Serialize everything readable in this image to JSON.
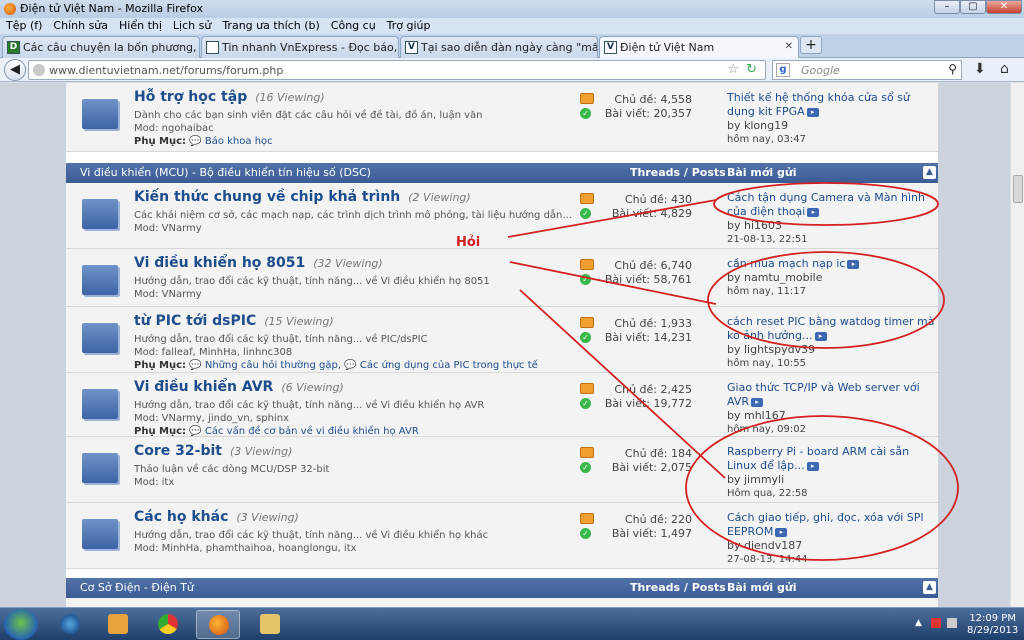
{
  "window": {
    "title": "Điện tử Việt Nam - Mozilla Firefox",
    "controls": [
      "–",
      "▢",
      "✕"
    ]
  },
  "menu": [
    "Tệp (f)",
    "Chỉnh sửa",
    "Hiển thị",
    "Lịch sử",
    "Trang ưa thích (b)",
    "Công cụ",
    "Trợ giúp"
  ],
  "tabs": [
    {
      "label": "Các câu chuyện la bốn phương, chuy...",
      "fav": "D"
    },
    {
      "label": "Tin nhanh VnExpress - Đọc báo, tin tứ...",
      "fav": ""
    },
    {
      "label": "Tại sao diễn đàn ngày càng \"mất lửa\"...",
      "fav": "V"
    },
    {
      "label": "Điện tử Việt Nam",
      "fav": "V"
    }
  ],
  "nav": {
    "url": "www.dientuvietnam.net/forums/forum.php",
    "search_placeholder": "Google",
    "search_engine": "g"
  },
  "forum": {
    "top": {
      "title": "Hỗ trợ học tập",
      "viewing": "(16 Viewing)",
      "desc": "Dành cho các bạn sinh viên đặt các câu hỏi về đề tài, đồ án, luận văn",
      "mod": "Mod: ngohaibac",
      "sub_label": "Phụ Mục:",
      "subs": [
        "Báo khoa học"
      ],
      "topics": "Chủ đề: 4,558",
      "posts": "Bài viết: 20,357",
      "last_title": "Thiết kế hệ thống khóa cửa sổ sử dụng kit FPGA",
      "last_by": "by klong19",
      "last_time": "hôm nay, 03:47"
    },
    "section1": {
      "name": "Vi điều khiển (MCU) - Bộ điều khiển tín hiệu số (DSC)",
      "threads_posts": "Threads / Posts",
      "last_post": "Bài mới gửi"
    },
    "rows": [
      {
        "title": "Kiến thức chung về chip khả trình",
        "viewing": "(2 Viewing)",
        "desc": "Các khái niệm cơ sở, các mạch nạp, các trình dịch trình mô phỏng, tài liệu hướng dẫn...",
        "mod": "Mod: VNarmy",
        "subs": [],
        "topics": "Chủ đề: 430",
        "posts": "Bài viết: 4,829",
        "last_title": "Cách tận dụng Camera và Màn hình của điện thoại",
        "last_by": "by hi1603",
        "last_time": "21-08-13, 22:51"
      },
      {
        "title": "Vi điều khiển họ 8051",
        "viewing": "(32 Viewing)",
        "desc": "Hướng dẫn, trao đổi các kỹ thuật, tính năng... về Vi điều khiển họ 8051",
        "mod": "Mod: VNarmy",
        "subs": [],
        "topics": "Chủ đề: 6,740",
        "posts": "Bài viết: 58,761",
        "last_title": "cần mua mạch nạp ic",
        "last_by": "by namtu_mobile",
        "last_time": "hôm nay, 11:17"
      },
      {
        "title": "từ PIC tới dsPIC",
        "viewing": "(15 Viewing)",
        "desc": "Hướng dẫn, trao đổi các kỹ thuật, tính năng... về PIC/dsPIC",
        "mod": "Mod: falleaf, MinhHa, linhnc308",
        "subs": [
          "Những câu hỏi thường gặp,",
          "Các ứng dụng của PIC trong thực tế"
        ],
        "topics": "Chủ đề: 1,933",
        "posts": "Bài viết: 14,231",
        "last_title": "cách reset PIC bằng watdog timer mà ko ảnh hưởng...",
        "last_by": "by lightspydv39",
        "last_time": "hôm nay, 10:55"
      },
      {
        "title": "Vi điều khiển AVR",
        "viewing": "(6 Viewing)",
        "desc": "Hướng dẫn, trao đổi các kỹ thuật, tính năng... về Vi điều khiển họ AVR",
        "mod": "Mod: VNarmy, jindo_vn, sphinx",
        "subs": [
          "Các vấn đề cơ bản về vi điều khiển họ AVR"
        ],
        "topics": "Chủ đề: 2,425",
        "posts": "Bài viết: 19,772",
        "last_title": "Giao thức TCP/IP và Web server với AVR",
        "last_by": "by mhl167",
        "last_time": "hôm nay, 09:02"
      },
      {
        "title": "Core 32-bit",
        "viewing": "(3 Viewing)",
        "desc": "Thảo luận về các dòng MCU/DSP 32-bit",
        "mod": "Mod: itx",
        "subs": [],
        "topics": "Chủ đề: 184",
        "posts": "Bài viết: 2,075",
        "last_title": "Raspberry Pi - board ARM cài sẵn Linux để lập...",
        "last_by": "by jimmyli",
        "last_time": "Hôm qua, 22:58"
      },
      {
        "title": "Các họ khác",
        "viewing": "(3 Viewing)",
        "desc": "Hướng dẫn, trao đổi các kỹ thuật, tính năng... về Vi điều khiển họ khác",
        "mod": "Mod: MinhHa, phamthaihoa, hoanglongu, itx",
        "subs": [],
        "topics": "Chủ đề: 220",
        "posts": "Bài viết: 1,497",
        "last_title": "Cách giao tiếp, ghi, đọc, xóa với SPI EEPROM",
        "last_by": "by diendv187",
        "last_time": "27-08-13, 14:44"
      }
    ],
    "sub_label": "Phụ Mục:",
    "section2": {
      "name": "Cơ Sở Điện - Điện Tử",
      "threads_posts": "Threads / Posts",
      "last_post": "Bài mới gửi"
    }
  },
  "annotation": {
    "text": "Hỏi",
    "color": "#d42020"
  },
  "taskbar": {
    "time": "12:09 PM",
    "date": "8/29/2013"
  }
}
